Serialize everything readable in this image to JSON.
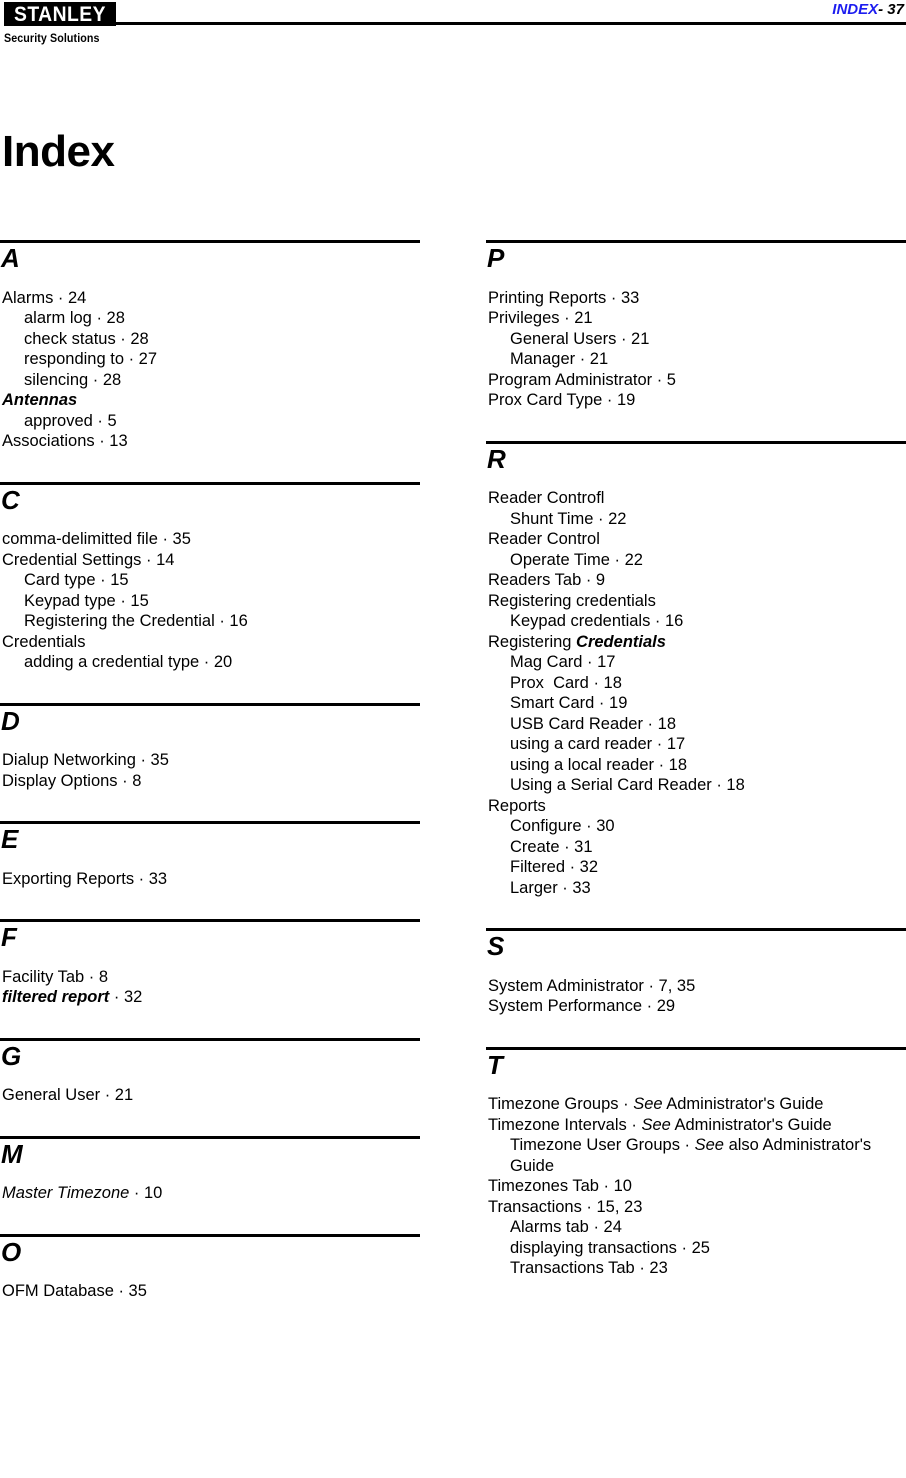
{
  "header": {
    "logo_text": "STANLEY",
    "tagline": "Security Solutions",
    "folio_label": "INDEX",
    "folio_number": "- 37",
    "accent_color": "#1d1df0"
  },
  "title": "Index",
  "columns": {
    "left": [
      {
        "letter": "A",
        "entries": [
          {
            "level": 1,
            "text": "Alarms · 24"
          },
          {
            "level": 2,
            "text": "alarm log · 28"
          },
          {
            "level": 2,
            "text": "check status · 28"
          },
          {
            "level": 2,
            "text": "responding to · 27"
          },
          {
            "level": 2,
            "text": "silencing · 28"
          },
          {
            "level": 1,
            "text": "Antennas",
            "style": "bold-italic"
          },
          {
            "level": 2,
            "text": "approved · 5"
          },
          {
            "level": 1,
            "text": "Associations · 13"
          }
        ]
      },
      {
        "letter": "C",
        "entries": [
          {
            "level": 1,
            "text": "comma-delimitted file · 35"
          },
          {
            "level": 1,
            "text": "Credential Settings · 14"
          },
          {
            "level": 2,
            "text": "Card type · 15"
          },
          {
            "level": 2,
            "text": "Keypad type · 15"
          },
          {
            "level": 2,
            "text": "Registering the Credential · 16"
          },
          {
            "level": 1,
            "text": "Credentials"
          },
          {
            "level": 2,
            "text": "adding a credential type · 20"
          }
        ]
      },
      {
        "letter": "D",
        "entries": [
          {
            "level": 1,
            "text": "Dialup Networking · 35"
          },
          {
            "level": 1,
            "text": "Display Options · 8"
          }
        ]
      },
      {
        "letter": "E",
        "entries": [
          {
            "level": 1,
            "text": "Exporting Reports · 33"
          }
        ]
      },
      {
        "letter": "F",
        "entries": [
          {
            "level": 1,
            "text": "Facility Tab · 8"
          },
          {
            "level": 1,
            "emphasis": "filtered report",
            "text": " · 32",
            "style": "bold-italic-lead"
          }
        ]
      },
      {
        "letter": "G",
        "entries": [
          {
            "level": 1,
            "text": "General User · 21"
          }
        ]
      },
      {
        "letter": "M",
        "entries": [
          {
            "level": 1,
            "emphasis": "Master Timezone",
            "text": " · 10",
            "style": "italic-lead"
          }
        ]
      },
      {
        "letter": "O",
        "entries": [
          {
            "level": 1,
            "text": "OFM Database · 35"
          }
        ]
      }
    ],
    "right": [
      {
        "letter": "P",
        "entries": [
          {
            "level": 1,
            "text": "Printing Reports · 33"
          },
          {
            "level": 1,
            "text": "Privileges · 21"
          },
          {
            "level": 2,
            "text": "General Users · 21"
          },
          {
            "level": 2,
            "text": "Manager · 21"
          },
          {
            "level": 1,
            "text": "Program Administrator · 5"
          },
          {
            "level": 1,
            "text": "Prox Card Type · 19"
          }
        ]
      },
      {
        "letter": "R",
        "entries": [
          {
            "level": 1,
            "text": "Reader Controfl"
          },
          {
            "level": 2,
            "text": "Shunt Time · 22"
          },
          {
            "level": 1,
            "text": "Reader Control"
          },
          {
            "level": 2,
            "text": "Operate Time · 22"
          },
          {
            "level": 1,
            "text": "Readers Tab · 9"
          },
          {
            "level": 1,
            "text": "Registering credentials"
          },
          {
            "level": 2,
            "text": "Keypad credentials · 16"
          },
          {
            "level": 1,
            "lead": "Registering ",
            "emphasis": "Credentials",
            "text": "",
            "style": "bold-italic-tail"
          },
          {
            "level": 2,
            "text": "Mag Card · 17"
          },
          {
            "level": 2,
            "text": "Prox  Card · 18"
          },
          {
            "level": 2,
            "text": "Smart Card · 19"
          },
          {
            "level": 2,
            "text": "USB Card Reader · 18"
          },
          {
            "level": 2,
            "text": "using a card reader · 17"
          },
          {
            "level": 2,
            "text": "using a local reader · 18"
          },
          {
            "level": 2,
            "text": "Using a Serial Card Reader · 18"
          },
          {
            "level": 1,
            "text": "Reports"
          },
          {
            "level": 2,
            "text": "Configure · 30"
          },
          {
            "level": 2,
            "text": "Create · 31"
          },
          {
            "level": 2,
            "text": "Filtered · 32"
          },
          {
            "level": 2,
            "text": "Larger · 33"
          }
        ]
      },
      {
        "letter": "S",
        "entries": [
          {
            "level": 1,
            "text": "System Administrator · 7, 35"
          },
          {
            "level": 1,
            "text": "System Performance · 29"
          }
        ]
      },
      {
        "letter": "T",
        "entries": [
          {
            "level": 1,
            "lead": "Timezone Groups · ",
            "emphasis": "See",
            "text": " Administrator's Guide",
            "style": "italic-mid"
          },
          {
            "level": 1,
            "lead": "Timezone Intervals · ",
            "emphasis": "See",
            "text": " Administrator's Guide",
            "style": "italic-mid"
          },
          {
            "level": 1,
            "lead": "Timezone User Groups · ",
            "emphasis": "See",
            "text": " also Administrator's Guide",
            "style": "italic-mid-wrap"
          },
          {
            "level": 1,
            "text": "Timezones Tab · 10"
          },
          {
            "level": 1,
            "text": "Transactions · 15, 23"
          },
          {
            "level": 2,
            "text": "Alarms tab · 24"
          },
          {
            "level": 2,
            "text": "displaying transactions · 25"
          },
          {
            "level": 2,
            "text": "Transactions Tab · 23"
          }
        ]
      }
    ]
  }
}
